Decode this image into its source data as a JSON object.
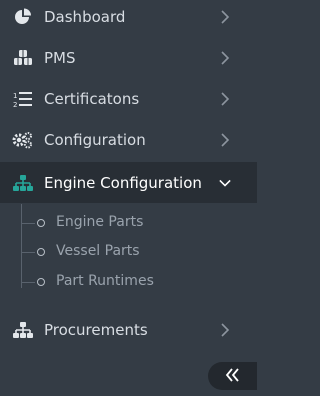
{
  "sidebar": {
    "items": [
      {
        "label": "Dashboard",
        "icon": "pie-chart-icon"
      },
      {
        "label": "PMS",
        "icon": "cubes-icon"
      },
      {
        "label": "Certificatons",
        "icon": "ordered-list-icon"
      },
      {
        "label": "Configuration",
        "icon": "gears-icon"
      },
      {
        "label": "Engine Configuration",
        "icon": "sitemap-icon",
        "expanded": true
      },
      {
        "label": "Procurements",
        "icon": "sitemap-icon"
      }
    ],
    "submenu": [
      {
        "label": "Engine Parts"
      },
      {
        "label": "Vessel Parts"
      },
      {
        "label": "Part Runtimes"
      }
    ],
    "collapse_icon": "double-chevron-left-icon"
  },
  "colors": {
    "background": "#343c45",
    "active_background": "#282e35",
    "accent": "#26a69a",
    "text": "#d8dde3",
    "submenu_text": "#9aa3ad"
  }
}
